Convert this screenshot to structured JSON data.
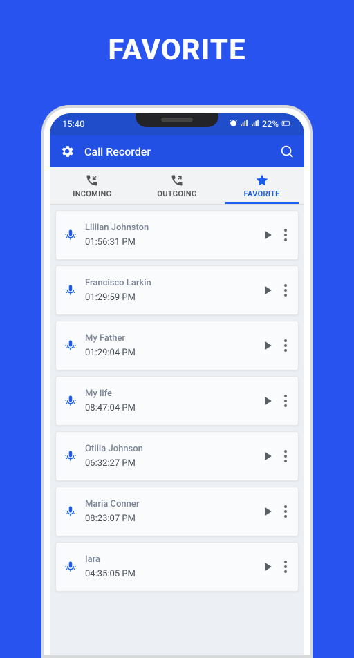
{
  "promo_title": "FAVORITE",
  "status": {
    "time": "15:40",
    "battery": "22%"
  },
  "appbar": {
    "title": "Call Recorder"
  },
  "tabs": {
    "incoming": "INCOMING",
    "outgoing": "OUTGOING",
    "favorite": "FAVORITE"
  },
  "recordings": [
    {
      "name": "Lillian Johnston",
      "time": "01:56:31 PM"
    },
    {
      "name": "Francisco Larkin",
      "time": "01:29:59 PM"
    },
    {
      "name": "My Father",
      "time": "01:29:04 PM"
    },
    {
      "name": "My life",
      "time": "08:47:04 PM"
    },
    {
      "name": "Otilia Johnson",
      "time": "06:32:27 PM"
    },
    {
      "name": "Maria Conner",
      "time": "08:23:07 PM"
    },
    {
      "name": "Iara",
      "time": "04:35:05 PM"
    }
  ]
}
